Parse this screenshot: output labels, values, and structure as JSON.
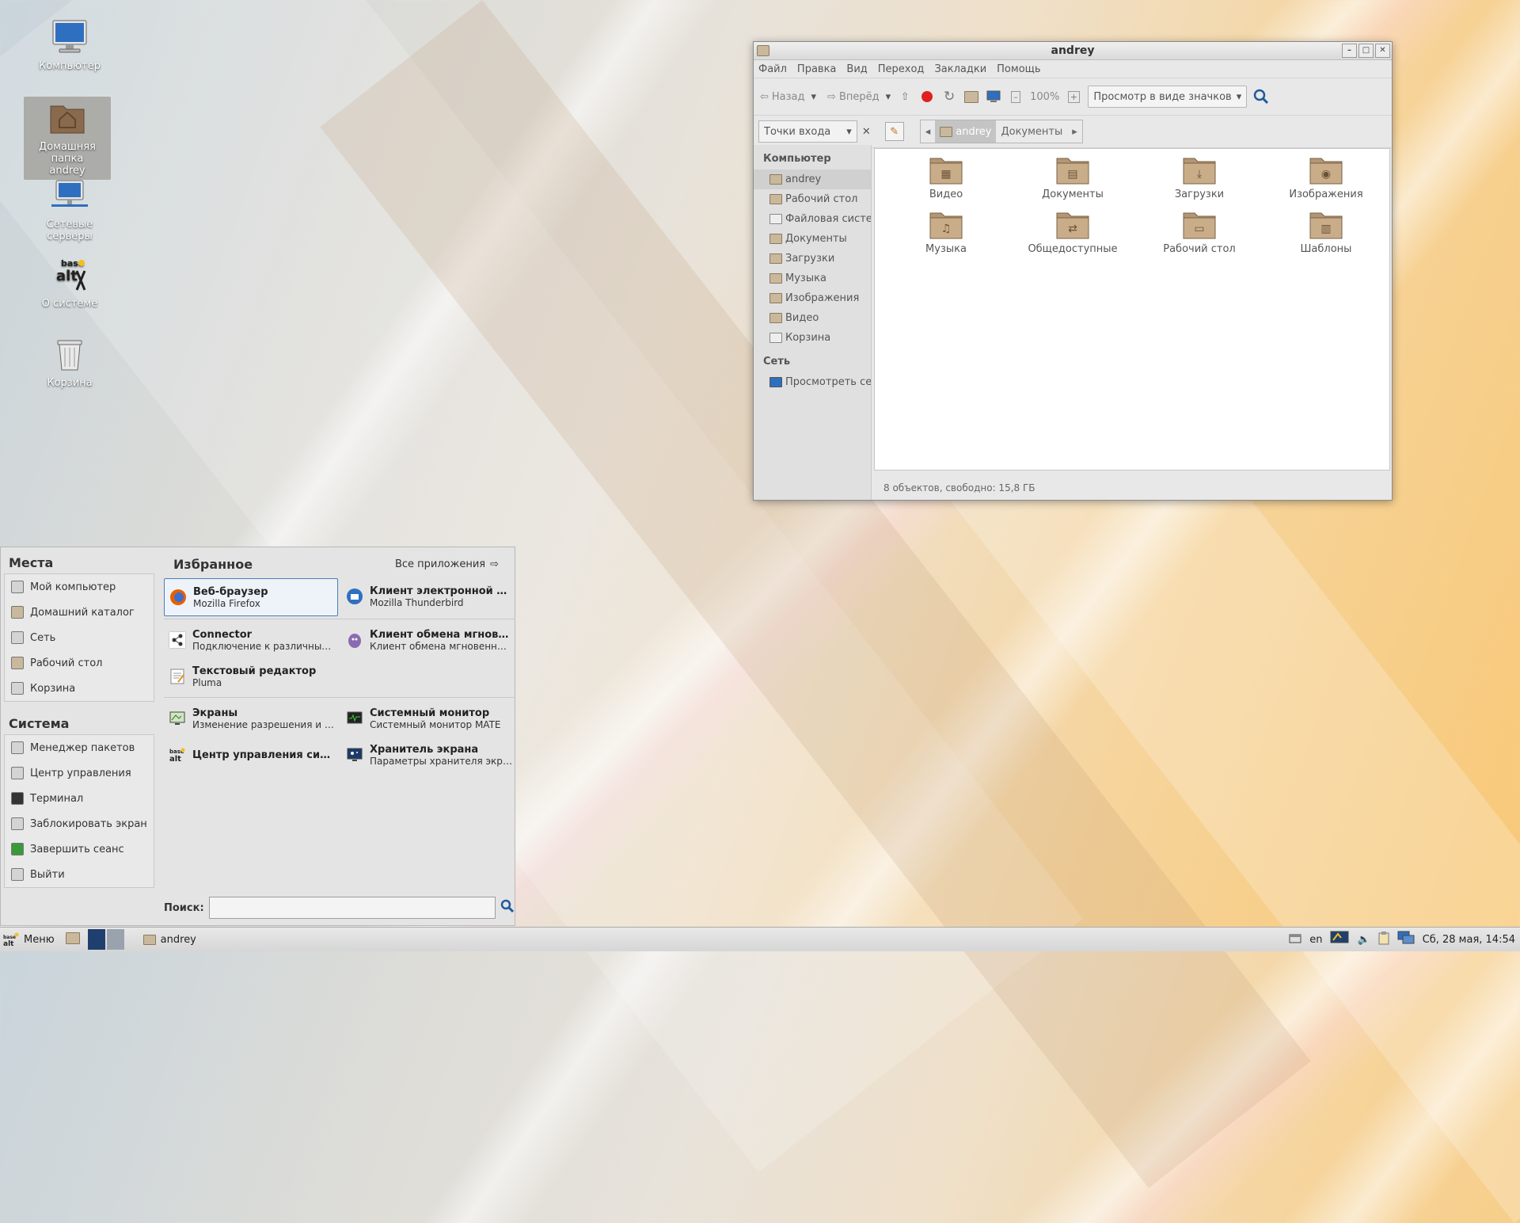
{
  "desktop": {
    "icons": [
      {
        "label": "Компьютер",
        "icon": "computer-icon"
      },
      {
        "label": "Домашняя папка\nandrey",
        "icon": "home-folder-icon"
      },
      {
        "label": "Сетевые серверы",
        "icon": "network-servers-icon"
      },
      {
        "label": "О системе",
        "icon": "about-system-icon"
      },
      {
        "label": "Корзина",
        "icon": "trash-icon"
      }
    ]
  },
  "file_manager": {
    "title": "andrey",
    "menu": [
      "Файл",
      "Правка",
      "Вид",
      "Переход",
      "Закладки",
      "Помощь"
    ],
    "toolbar": {
      "back": "Назад",
      "forward": "Вперёд",
      "zoom": "100%",
      "view_mode": "Просмотр в виде значков"
    },
    "location": {
      "places_combo": "Точки входа",
      "path": [
        "andrey",
        "Документы"
      ]
    },
    "sidebar": {
      "computer_header": "Компьютер",
      "items": [
        "andrey",
        "Рабочий стол",
        "Файловая систе...",
        "Документы",
        "Загрузки",
        "Музыка",
        "Изображения",
        "Видео",
        "Корзина"
      ],
      "network_header": "Сеть",
      "network_items": [
        "Просмотреть сеть"
      ]
    },
    "folders": [
      "Видео",
      "Документы",
      "Загрузки",
      "Изображения",
      "Музыка",
      "Общедоступные",
      "Рабочий стол",
      "Шаблоны"
    ],
    "status": "8 объектов, свободно: 15,8 ГБ"
  },
  "start_menu": {
    "places_header": "Места",
    "places": [
      "Мой компьютер",
      "Домашний каталог",
      "Сеть",
      "Рабочий стол",
      "Корзина"
    ],
    "system_header": "Система",
    "system": [
      "Менеджер пакетов",
      "Центр управления",
      "Терминал",
      "Заблокировать экран",
      "Завершить сеанс",
      "Выйти"
    ],
    "favorites_header": "Избранное",
    "all_apps": "Все приложения",
    "apps": [
      {
        "title": "Веб-браузер",
        "subtitle": "Mozilla Firefox"
      },
      {
        "title": "Клиент электронной почты",
        "subtitle": "Mozilla Thunderbird"
      },
      {
        "title": "Connector",
        "subtitle": "Подключение к различным с..."
      },
      {
        "title": "Клиент обмена мгновенны...",
        "subtitle": "Клиент обмена мгновенным..."
      },
      {
        "title": "Текстовый редактор",
        "subtitle": "Pluma"
      },
      {
        "title": "Экраны",
        "subtitle": "Изменение разрешения и п..."
      },
      {
        "title": "Системный монитор",
        "subtitle": "Системный монитор MATE"
      },
      {
        "title": "Центр управления систем...",
        "subtitle": ""
      },
      {
        "title": "Хранитель экрана",
        "subtitle": "Параметры хранителя экрана"
      }
    ],
    "search_label": "Поиск:",
    "search_placeholder": ""
  },
  "taskbar": {
    "menu_label": "Меню",
    "task_label": "andrey",
    "lang": "en",
    "clock": "Сб, 28 мая, 14:54"
  },
  "colors": {
    "selection": "#4a7eb8",
    "folder": "#c9b89b",
    "record": "#e02020"
  }
}
